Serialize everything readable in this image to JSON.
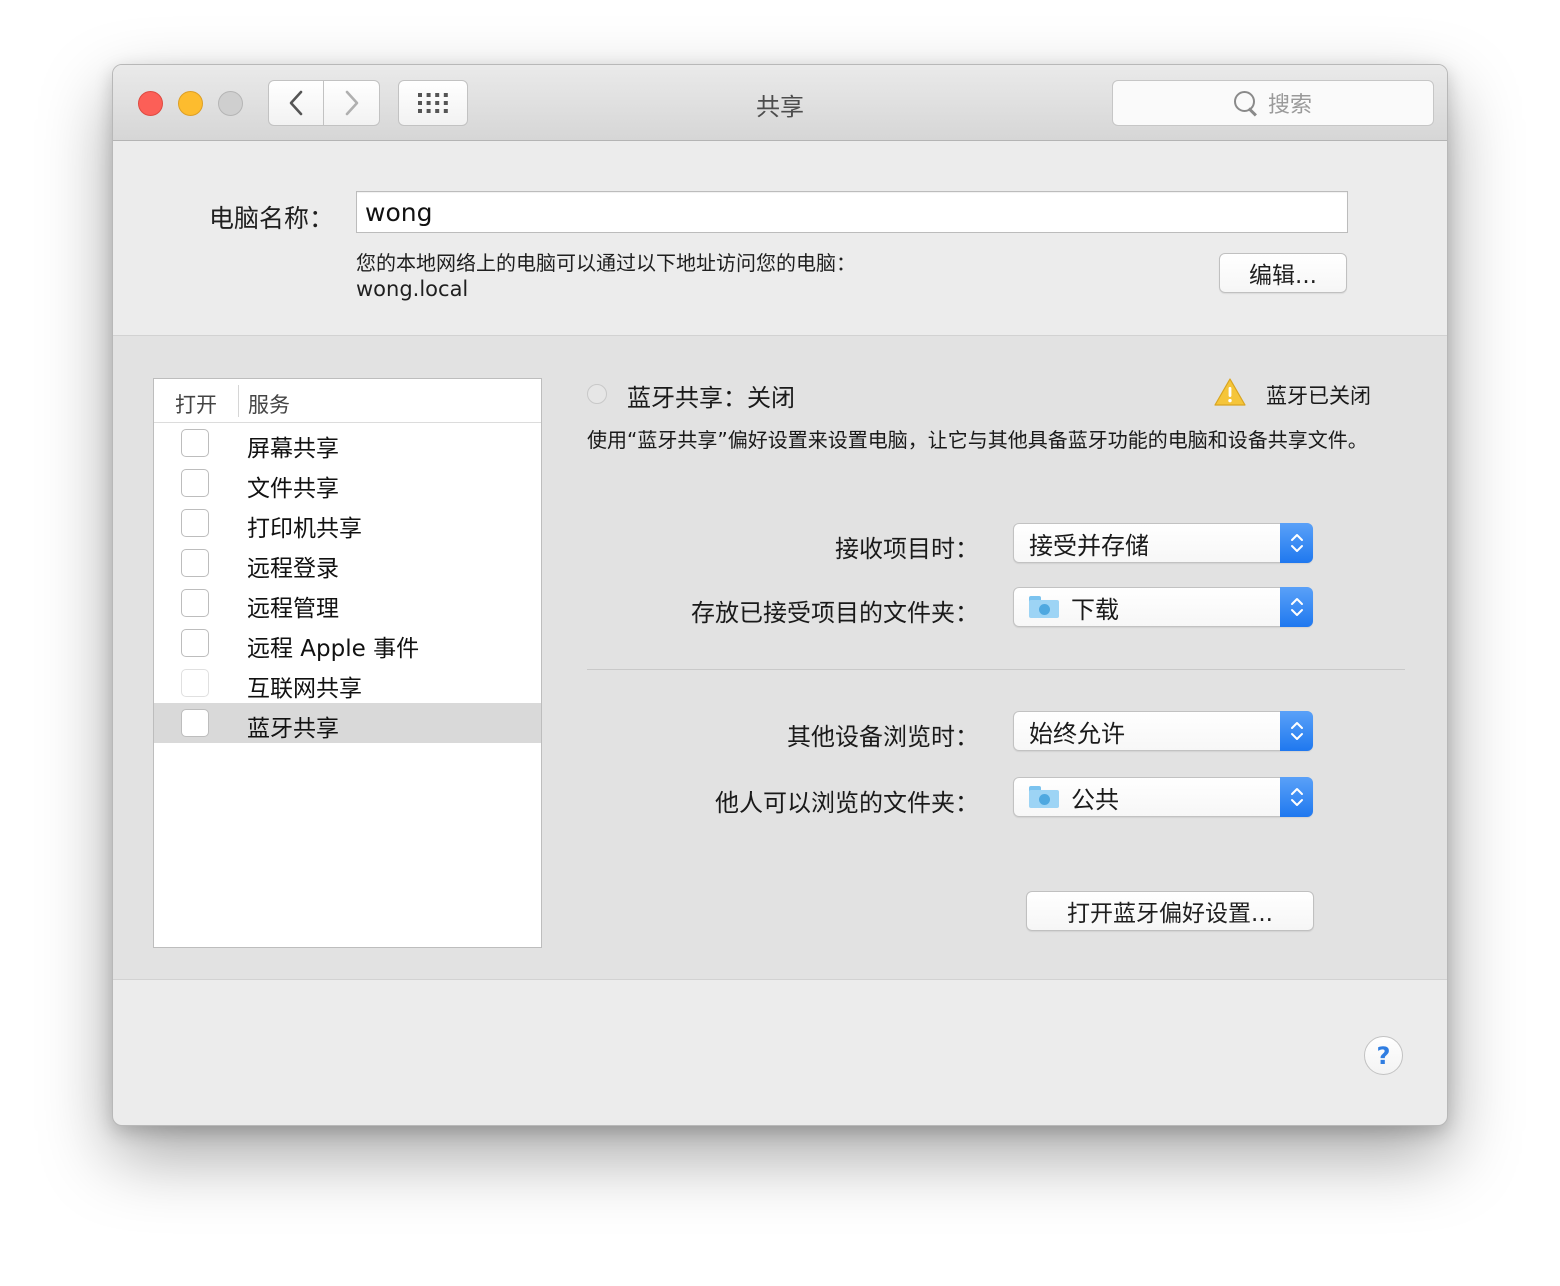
{
  "window": {
    "title": "共享",
    "search_placeholder": "搜索"
  },
  "computer_name": {
    "label": "电脑名称：",
    "value": "wong",
    "access_note": "您的本地网络上的电脑可以通过以下地址访问您的电脑：",
    "address": "wong.local",
    "edit_button": "编辑..."
  },
  "services": {
    "header_on": "打开",
    "header_service": "服务",
    "items": [
      {
        "label": "屏幕共享",
        "checked": false,
        "enabled": true
      },
      {
        "label": "文件共享",
        "checked": false,
        "enabled": true
      },
      {
        "label": "打印机共享",
        "checked": false,
        "enabled": true
      },
      {
        "label": "远程登录",
        "checked": false,
        "enabled": true
      },
      {
        "label": "远程管理",
        "checked": false,
        "enabled": true
      },
      {
        "label": "远程 Apple 事件",
        "checked": false,
        "enabled": true
      },
      {
        "label": "互联网共享",
        "checked": false,
        "enabled": false
      },
      {
        "label": "蓝牙共享",
        "checked": false,
        "enabled": true,
        "selected": true
      }
    ]
  },
  "detail": {
    "status": "蓝牙共享：关闭",
    "warning": "蓝牙已关闭",
    "description": "使用“蓝牙共享”偏好设置来设置电脑，让它与其他具备蓝牙功能的电脑和设备共享文件。",
    "receive_label": "接收项目时：",
    "receive_value": "接受并存储",
    "folder_label": "存放已接受项目的文件夹：",
    "folder_value": "下载",
    "browse_label": "其他设备浏览时：",
    "browse_value": "始终允许",
    "browse_folder_label": "他人可以浏览的文件夹：",
    "browse_folder_value": "公共",
    "open_prefs_button": "打开蓝牙偏好设置..."
  },
  "help": "?",
  "colors": {
    "accent": "#2f7de1",
    "close": "#fc5f57",
    "minimize": "#fdbc2e",
    "zoom_disabled": "#cfcfcf",
    "warning": "#f5c53a"
  },
  "icons": [
    "back-chevron-icon",
    "forward-chevron-icon",
    "grid-icon",
    "search-icon",
    "warning-icon",
    "folder-icon",
    "stepper-arrows-icon",
    "help-icon"
  ]
}
